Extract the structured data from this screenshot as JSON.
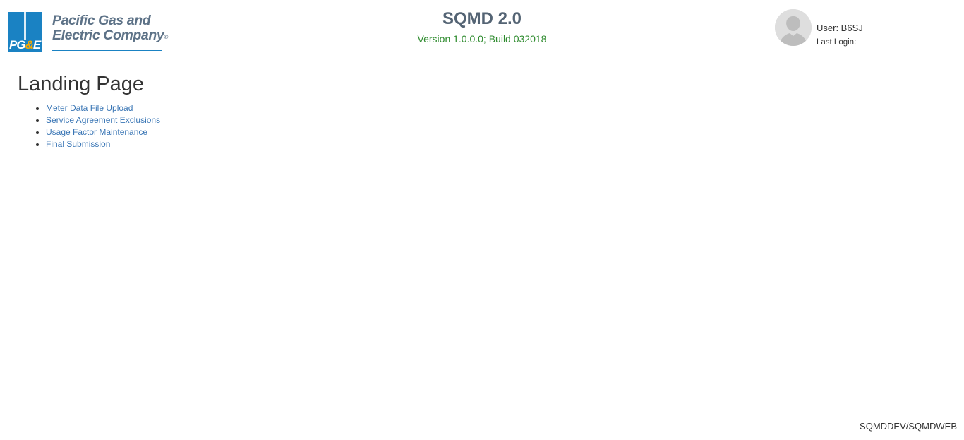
{
  "header": {
    "logo": {
      "mark_letters_pg": "PG",
      "mark_letters_amp": "&",
      "mark_letters_e": "E",
      "company_line1": "Pacific Gas and",
      "company_line2": "Electric Company",
      "registered_mark": "®",
      "brand_blue": "#1a82c3",
      "brand_orange": "#f6a800"
    },
    "app_title": "SQMD 2.0",
    "app_version": "Version 1.0.0.0; Build 032018",
    "user": {
      "avatar_icon": "user-silhouette-icon",
      "name_text": "User: B6SJ",
      "last_login_text": "Last Login:"
    }
  },
  "main": {
    "page_title": "Landing Page",
    "links": [
      {
        "label": "Meter Data File Upload"
      },
      {
        "label": "Service Agreement Exclusions"
      },
      {
        "label": "Usage Factor Maintenance"
      },
      {
        "label": "Final Submission"
      }
    ]
  },
  "footer": {
    "environment": "SQMDDEV/SQMDWEB"
  },
  "colors": {
    "link": "#3a76b5",
    "version_text": "#2e8b2e",
    "title_text": "#546474"
  }
}
